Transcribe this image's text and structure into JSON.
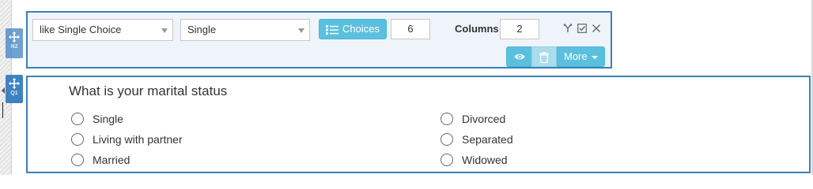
{
  "toolbar": {
    "question_type": "like Single Choice",
    "selection_mode": "Single",
    "choices_button": "Choices",
    "choices_count": "6",
    "columns_label": "Columns",
    "columns_count": "2",
    "more_button": "More"
  },
  "handles": {
    "toolbar_label": "N2",
    "question_label": "Q1"
  },
  "question": {
    "title": "What is your marital status",
    "options": [
      {
        "label": "Single"
      },
      {
        "label": "Living with partner"
      },
      {
        "label": "Married"
      },
      {
        "label": "Divorced"
      },
      {
        "label": "Separated"
      },
      {
        "label": "Widowed"
      }
    ]
  },
  "colors": {
    "accent_blue": "#3f7fb5",
    "button_info": "#5bc0de",
    "toolbar_bg": "#eef4fa"
  },
  "icons": [
    "move-icon",
    "choices-list-icon",
    "branch-icon",
    "checkbox-icon",
    "close-icon",
    "eye-icon",
    "trash-icon",
    "caret-down-icon"
  ]
}
